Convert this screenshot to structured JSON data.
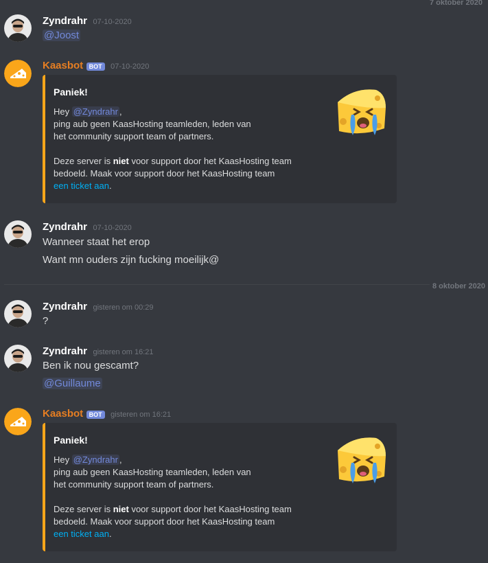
{
  "top_date_label": "7 oktober 2020",
  "divider_label": "8 oktober 2020",
  "colors": {
    "background": "#36393f",
    "embed_bg": "#2f3136",
    "embed_accent": "#faa61a",
    "mention": "#7289da",
    "link": "#00b0f4",
    "bot_name": "#e67e22"
  },
  "messages": [
    {
      "author": "Zyndrahr",
      "timestamp": "07-10-2020",
      "lines": [
        "@Joost"
      ]
    },
    {
      "author": "Kaasbot",
      "bot_tag": "BOT",
      "timestamp": "07-10-2020",
      "embed": {
        "title": "Paniek!",
        "hey": "Hey ",
        "mention": "@Zyndrahr",
        "comma": ",",
        "line2": "ping aub geen KaasHosting teamleden, leden van",
        "line3": "het community support team of partners.",
        "line4_a": "Deze server is ",
        "line4_bold": "niet",
        "line4_b": " voor support door het KaasHosting team",
        "line5": "bedoeld. Maak voor support door het KaasHosting team",
        "link": "een ticket aan",
        "period": ".",
        "thumbnail_icon": "crying-cheese-icon"
      }
    },
    {
      "author": "Zyndrahr",
      "timestamp": "07-10-2020",
      "lines": [
        "Wanneer staat het erop",
        "Want mn ouders zijn fucking moeilijk@"
      ]
    },
    {
      "author": "Zyndrahr",
      "timestamp": "gisteren om 00:29",
      "lines": [
        "?"
      ]
    },
    {
      "author": "Zyndrahr",
      "timestamp": "gisteren om 16:21",
      "lines": [
        "Ben ik nou gescamt?",
        "@Guillaume"
      ]
    },
    {
      "author": "Kaasbot",
      "bot_tag": "BOT",
      "timestamp": "gisteren om 16:21",
      "embed": {
        "title": "Paniek!",
        "hey": "Hey ",
        "mention": "@Zyndrahr",
        "comma": ",",
        "line2": "ping aub geen KaasHosting teamleden, leden van",
        "line3": "het community support team of partners.",
        "line4_a": "Deze server is ",
        "line4_bold": "niet",
        "line4_b": " voor support door het KaasHosting team",
        "line5": "bedoeld. Maak voor support door het KaasHosting team",
        "link": "een ticket aan",
        "period": ".",
        "thumbnail_icon": "crying-cheese-icon"
      }
    }
  ]
}
